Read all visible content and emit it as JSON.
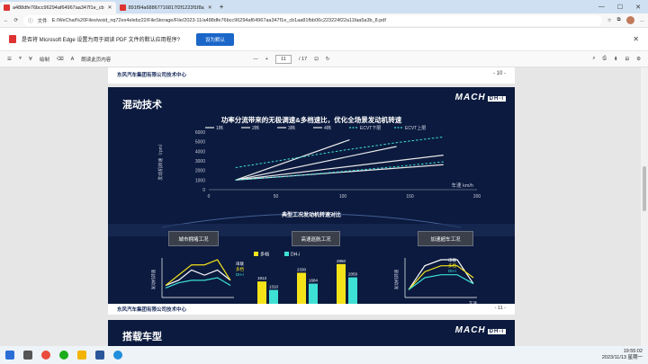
{
  "browser": {
    "tabs": [
      {
        "label": "a488dfe76bcc96294af64967aa347f1e_cb",
        "active": true
      },
      {
        "label": "891f94a68867716817f2f1223f1f8a",
        "active": false
      }
    ],
    "address_prefix": "文件",
    "url": "E:/WeChat%20Files/wxid_nq72ex4elebz22/FileStorage/File/2023-11/a488dfe76bcc96294af64967aa347f1e_cb1aa81fbb06c223224f22a11faa5a3b_8.pdf"
  },
  "notice": {
    "text": "是否将 Microsoft Edge 设置为用于阅读 PDF 文件的默认应用程序?",
    "button": "设为默认"
  },
  "pdf_toolbar": {
    "draw": "绘制",
    "read_aloud": "朗读此页内容",
    "page_current": "11",
    "page_total": "/ 17"
  },
  "slide_prev": {
    "page_number": "- 10 -",
    "company": "东风汽车集团有限公司技术中心"
  },
  "slide": {
    "title": "混动技术",
    "brand": "MACH",
    "brand_badge": "DH-i",
    "subtitle": "功率分流带来的无极调速&多档速比，优化全场景发动机转速",
    "compare_title": "典型工况发动机转速对比",
    "scenarios": [
      "城市拥堵工况",
      "高速巡航工况",
      "加速超车工况"
    ],
    "company": "东风汽车集团有限公司技术中心",
    "company_en": "DONGFENG MOTOR CORPORATION TECHNICAL CENTER",
    "page_number": "- 11 -"
  },
  "slide_next": {
    "title": "搭载车型",
    "brand": "MACH",
    "brand_badge": "DH-i"
  },
  "taskbar": {
    "time": "19:55:02",
    "date": "2023/11/13 星期一"
  },
  "chart_data": [
    {
      "type": "line",
      "ylabel": "发动机转速（rpm）",
      "xlabel": "车速 km/h",
      "xlim": [
        0,
        200
      ],
      "ylim": [
        0,
        6000
      ],
      "xticks": [
        0,
        50,
        100,
        150,
        200
      ],
      "yticks": [
        0,
        1000,
        2000,
        3000,
        4000,
        5000,
        6000
      ],
      "series": [
        {
          "name": "1档",
          "x": [
            20,
            105
          ],
          "y": [
            1000,
            5200
          ]
        },
        {
          "name": "2档",
          "x": [
            20,
            140
          ],
          "y": [
            1000,
            4500
          ]
        },
        {
          "name": "3档",
          "x": [
            20,
            175
          ],
          "y": [
            1000,
            3600
          ]
        },
        {
          "name": "4档",
          "x": [
            20,
            175
          ],
          "y": [
            1000,
            2600
          ]
        },
        {
          "name": "ECVT下限",
          "x": [
            20,
            60,
            100,
            140,
            175
          ],
          "y": [
            1000,
            1400,
            1900,
            2400,
            2900
          ]
        },
        {
          "name": "ECVT上限",
          "x": [
            20,
            60,
            100,
            140,
            175
          ],
          "y": [
            2300,
            3200,
            4100,
            4900,
            5500
          ]
        }
      ],
      "colors": {
        "gear": "#e8e8e8",
        "ecvt": "#3ee0d6"
      }
    },
    {
      "type": "line",
      "ylabel": "发动机转速",
      "xlabel": "",
      "series": [
        {
          "name": "串联",
          "color": "#ffffff",
          "values": [
            2,
            3,
            5,
            4,
            5,
            3
          ]
        },
        {
          "name": "多档",
          "color": "#f5e31a",
          "values": [
            2,
            4,
            6,
            6,
            7,
            3
          ]
        },
        {
          "name": "DH-i",
          "color": "#3ee0d6",
          "values": [
            1.5,
            2.5,
            3,
            3,
            3.5,
            2
          ]
        }
      ]
    },
    {
      "type": "bar",
      "categories": [
        "80km/h",
        "100km/h",
        "120km/h"
      ],
      "series": [
        {
          "name": "多档",
          "color": "#f5e31a",
          "values": [
            1813,
            2330,
            2850
          ]
        },
        {
          "name": "DH-i",
          "color": "#3ee0d6",
          "values": [
            1310,
            1684,
            2059
          ]
        }
      ]
    },
    {
      "type": "line",
      "ylabel": "发动机转速",
      "xlabel": "车速",
      "series": [
        {
          "name": "串联",
          "color": "#ffffff",
          "values": [
            1,
            5,
            6,
            6,
            2
          ]
        },
        {
          "name": "多档",
          "color": "#f5e31a",
          "values": [
            1,
            4,
            5,
            5,
            3
          ]
        },
        {
          "name": "DH-i",
          "color": "#3ee0d6",
          "values": [
            1,
            3,
            3.5,
            3.5,
            2
          ]
        }
      ]
    }
  ]
}
